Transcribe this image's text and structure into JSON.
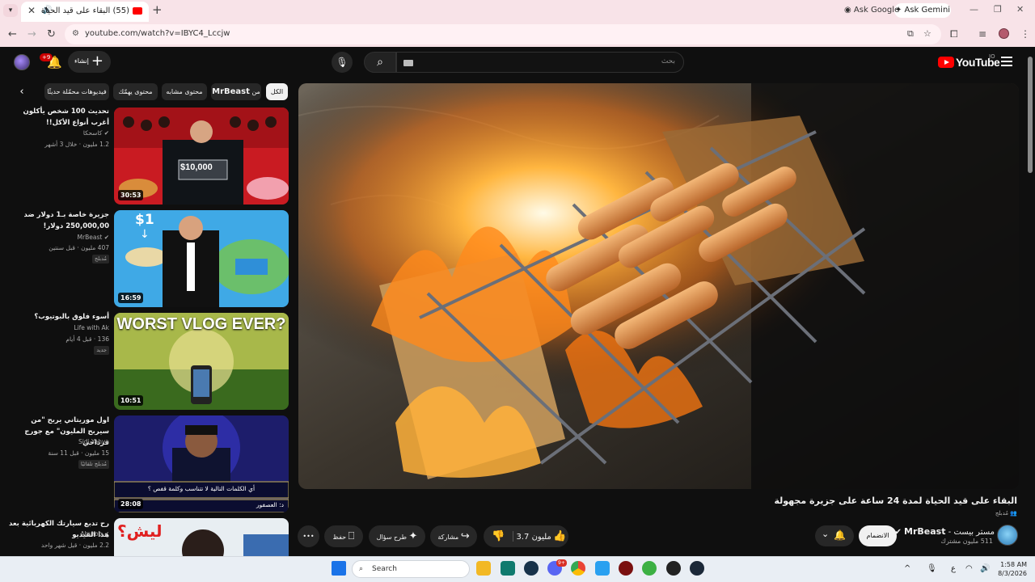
{
  "browser": {
    "tab_title": "(55) البقاء على قيد الحياة لمد...",
    "ask_gemini": "Ask Gemini",
    "url": "youtube.com/watch?v=IBYC4_Lccjw",
    "ask_google": "Ask Google"
  },
  "masthead": {
    "logo_text": "YouTube",
    "logo_suffix": "JO",
    "search_placeholder": "بحث",
    "create_label": "إنشاء",
    "notification_count": "+9"
  },
  "chips": {
    "all": "الكل",
    "from_channel_prefix": "من",
    "from_channel_name": "MrBeast",
    "similar": "محتوى مشابه",
    "for_you": "محتوى يهمّك",
    "recently_uploaded": "فيديوهات محمّلة حديثًا"
  },
  "video": {
    "title": "البقاء على قيد الحياة لمدة 24 ساعة على جزيرة مجهولة",
    "badge": "مُدبلج",
    "channel_ar": "مستر بيست -",
    "channel": "MrBeast",
    "subscribers": "511 مليون مشترك",
    "join_label": "الانضمام",
    "likes": "3.7 مليون",
    "share_label": "مشاركة",
    "ask_label": "طرح سؤال",
    "save_label": "حفظ"
  },
  "recommendations": [
    {
      "title": "تحديث 100 شخص يأكلون أغرب أنواع الأكل!!",
      "channel": "كاسحكا",
      "meta": "1.2 مليون · خلال 3 أشهر",
      "duration": "30:53",
      "badge": ""
    },
    {
      "title": "جزيرة خاصة بـ1 دولار ضد 250,000,00 دولار!",
      "channel": "MrBeast",
      "meta": "407 مليون · قبل سنتين",
      "duration": "16:59",
      "badge": "مُدبلج"
    },
    {
      "title": "أسوء فلوق بالبوتيوب؟",
      "channel": "Life with Ak",
      "meta": "136 · قبل 4 أيام",
      "duration": "10:51",
      "badge": "جديد",
      "thumb_text": "WORST VLOG EVER?"
    },
    {
      "title": "اول موريتاني يربح \"من سيربح المليون\" مع جورج قرداحي",
      "channel": "Sidi Yahya",
      "meta": "15 مليون · قبل 11 سنة",
      "duration": "28:08",
      "badge": "مُدبلج تلقائيًا",
      "thumb_q": "أي الكلمات التالية لا تتناسب وكلمة قفص ؟",
      "thumb_a": "العصفور",
      "thumb_a_letter": "د:"
    },
    {
      "title": "رح تدبع سيارتك الكهربائية بعد هذا الفيديو",
      "channel": "Aburob",
      "meta": "2.2 مليون · قبل شهر واحد",
      "duration": "",
      "badge": "",
      "thumb_text": "ليش؟"
    }
  ],
  "taskbar": {
    "search_placeholder": "Search",
    "time": "1:58 AM",
    "date": "8/3/2026",
    "lang": "ع",
    "steam_badge": "9+"
  }
}
